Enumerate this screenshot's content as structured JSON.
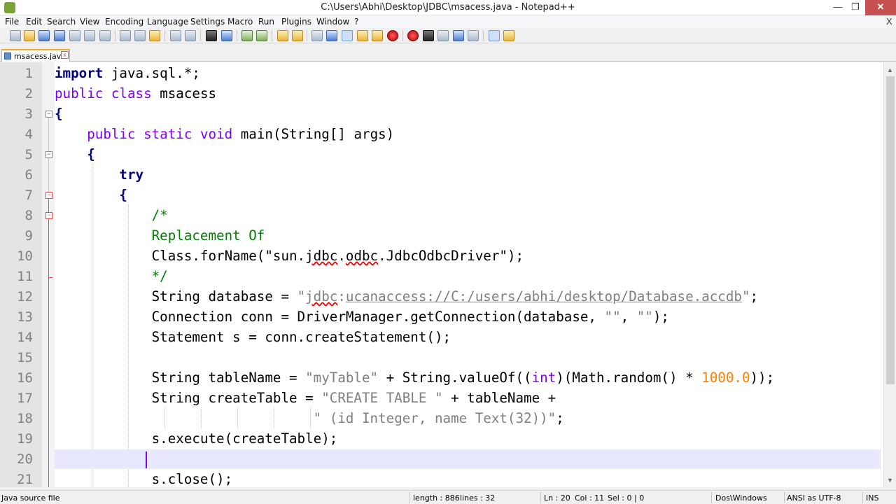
{
  "window": {
    "title": "C:\\Users\\Abhi\\Desktop\\JDBC\\msacess.java - Notepad++",
    "minimize": "—",
    "maximize": "❐",
    "close": "✕"
  },
  "menu": {
    "items": [
      "File",
      "Edit",
      "Search",
      "View",
      "Encoding",
      "Language",
      "Settings",
      "Macro",
      "Run",
      "Plugins",
      "Window",
      "?"
    ],
    "close_doc": "X"
  },
  "toolbar": {
    "icons": [
      "new-file-icon",
      "open-file-icon",
      "save-icon",
      "save-all-icon",
      "close-icon",
      "close-all-icon",
      "print-icon",
      "cut-icon",
      "copy-icon",
      "paste-icon",
      "undo-icon",
      "redo-icon",
      "find-icon",
      "replace-icon",
      "zoom-in-icon",
      "zoom-out-icon",
      "sync-vertical-icon",
      "sync-horizontal-icon",
      "word-wrap-icon",
      "show-all-chars-icon",
      "indent-guide-icon",
      "user-language-icon",
      "function-list-icon",
      "folder-workspace-icon",
      "doc-map-icon",
      "record-macro-icon",
      "stop-record-icon",
      "play-macro-icon",
      "run-macro-multiple-icon",
      "save-macro-icon",
      "spell-check-icon",
      "plugin-icon"
    ]
  },
  "tabs": [
    {
      "label": "msacess.java",
      "close": "x"
    }
  ],
  "editor": {
    "current_line": 20,
    "lines": [
      {
        "n": "1"
      },
      {
        "n": "2"
      },
      {
        "n": "3"
      },
      {
        "n": "4"
      },
      {
        "n": "5"
      },
      {
        "n": "6"
      },
      {
        "n": "7"
      },
      {
        "n": "8"
      },
      {
        "n": "9"
      },
      {
        "n": "10"
      },
      {
        "n": "11"
      },
      {
        "n": "12"
      },
      {
        "n": "13"
      },
      {
        "n": "14"
      },
      {
        "n": "15"
      },
      {
        "n": "16"
      },
      {
        "n": "17"
      },
      {
        "n": "18"
      },
      {
        "n": "19"
      },
      {
        "n": "20"
      },
      {
        "n": "21"
      }
    ],
    "code": {
      "l1": {
        "kw": "import",
        "rest": " java.sql.*;"
      },
      "l2": {
        "a": "public",
        "b": "class",
        "rest": " msacess"
      },
      "l3": {
        "brace": "{"
      },
      "l4": {
        "a": "public",
        "b": "static",
        "c": "void",
        "rest1": " main(",
        "typ": "String",
        "rest2": "[] args)"
      },
      "l5": {
        "brace": "{"
      },
      "l6": {
        "kw": "try"
      },
      "l7": {
        "brace": "{"
      },
      "l8": {
        "cmt": "/*"
      },
      "l9": {
        "cmt": "Replacement Of"
      },
      "l10": {
        "p1": "Class.forName(\"sun.",
        "sq1": "jdbc",
        "p2": ".",
        "sq2": "odbc",
        "p3": ".JdbcOdbcDriver\");"
      },
      "l11": {
        "cmt": "*/"
      },
      "l12": {
        "p1": "String database = ",
        "q1": "\"",
        "sq": "jdbc",
        "colon": ":",
        "url": "ucanaccess://C:/users/abhi/desktop/Database.accdb",
        "q2": "\"",
        "end": ";"
      },
      "l13": {
        "p1": "Connection conn = DriverManager.getConnection(database, ",
        "s1": "\"\"",
        "p2": ", ",
        "s2": "\"\"",
        "end": ");"
      },
      "l14": {
        "p1": "Statement s = conn.createStatement();"
      },
      "l16": {
        "p1": "String tableName = ",
        "s1": "\"myTable\"",
        "p2": " + String.valueOf((",
        "typ": "int",
        "p3": ")(Math.random() * ",
        "num": "1000.0",
        "end": "));"
      },
      "l17": {
        "p1": "String createTable = ",
        "s1": "\"CREATE TABLE \"",
        "p2": " + tableName +"
      },
      "l18": {
        "s1": "\" (id Integer, name Text(32))\"",
        "end": ";"
      },
      "l19": {
        "p1": "s.execute(createTable);"
      },
      "l21": {
        "p1": "s.close();"
      }
    }
  },
  "status": {
    "file_type": "Java source file",
    "length": "length : 886",
    "lines": "lines : 32",
    "ln": "Ln : 20",
    "col": "Col : 11",
    "sel": "Sel : 0 | 0",
    "eol": "Dos\\Windows",
    "encoding": "ANSI as UTF-8",
    "mode": "INS"
  }
}
